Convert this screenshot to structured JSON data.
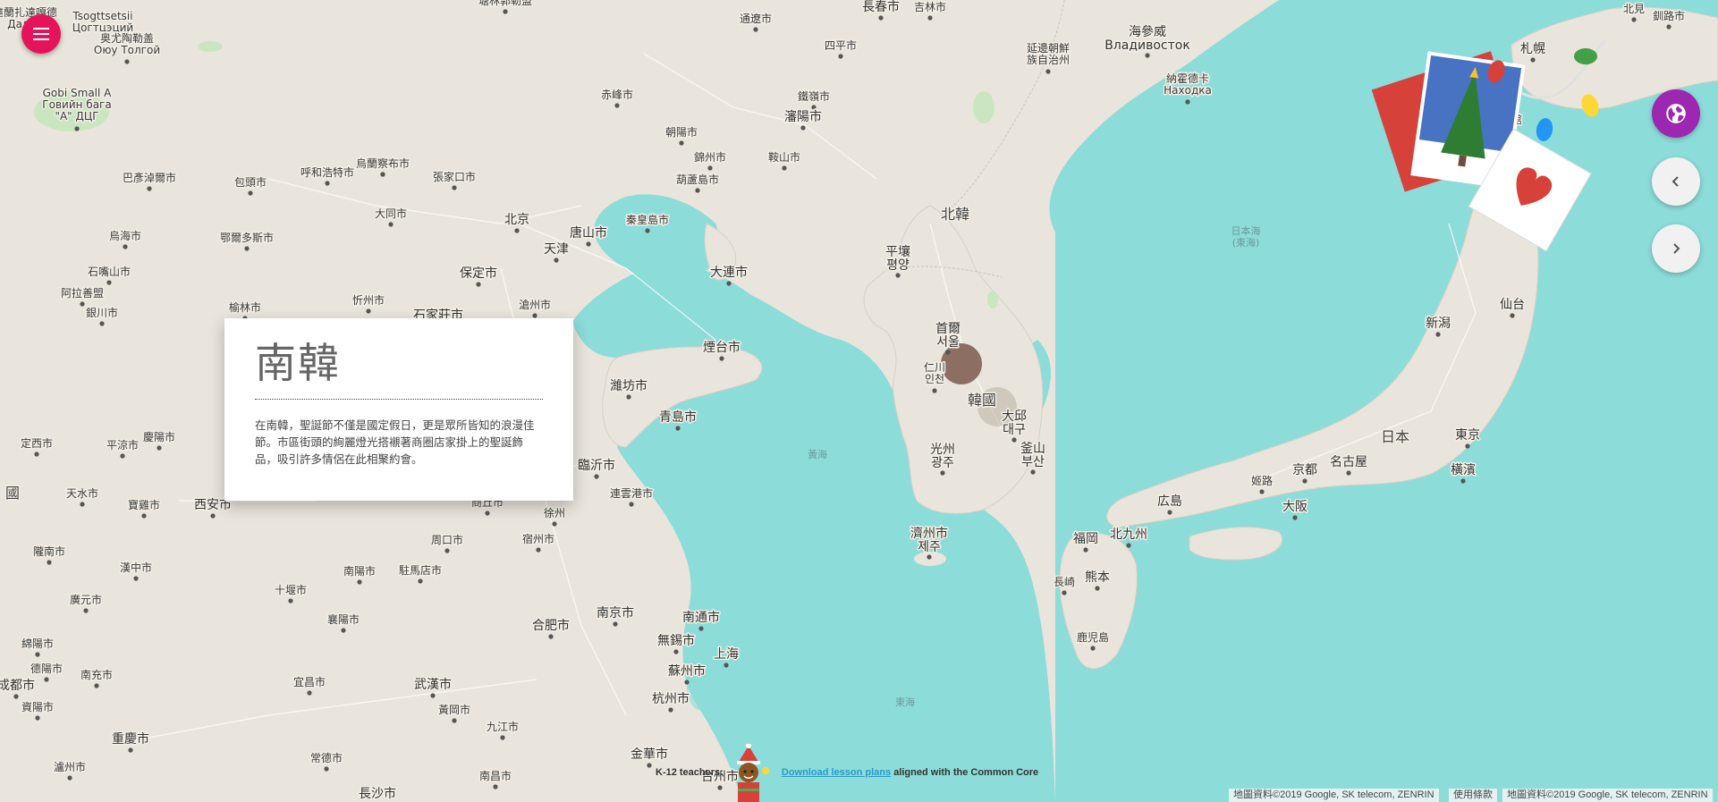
{
  "map": {
    "countries": [
      {
        "name": "北韓"
      },
      {
        "name": "韓國"
      },
      {
        "name": "日本"
      },
      {
        "name": "國"
      }
    ],
    "seas": [
      {
        "name": "黃海"
      },
      {
        "name": "東海"
      },
      {
        "name": "日本海\n(東海)"
      }
    ],
    "cities": [
      {
        "name": "長春市"
      },
      {
        "name": "吉林市"
      },
      {
        "name": "通遼市"
      },
      {
        "name": "四平市"
      },
      {
        "name": "海參威\nВладивосток"
      },
      {
        "name": "延邊朝鮮\n族自治州"
      },
      {
        "name": "納霍德卡\nНаходка"
      },
      {
        "name": "赤峰市"
      },
      {
        "name": "鐵嶺市"
      },
      {
        "name": "瀋陽市"
      },
      {
        "name": "朝陽市"
      },
      {
        "name": "錦州市"
      },
      {
        "name": "鞍山市"
      },
      {
        "name": "葫蘆島市"
      },
      {
        "name": "烏蘭察布市"
      },
      {
        "name": "呼和浩特市"
      },
      {
        "name": "張家口市"
      },
      {
        "name": "包頭市"
      },
      {
        "name": "巴彥淖爾市"
      },
      {
        "name": "大同市"
      },
      {
        "name": "北京"
      },
      {
        "name": "唐山市"
      },
      {
        "name": "秦皇島市"
      },
      {
        "name": "天津"
      },
      {
        "name": "鄂爾多斯市"
      },
      {
        "name": "烏海市"
      },
      {
        "name": "石嘴山市"
      },
      {
        "name": "保定市"
      },
      {
        "name": "大連市"
      },
      {
        "name": "阿拉善盟"
      },
      {
        "name": "銀川市"
      },
      {
        "name": "榆林市"
      },
      {
        "name": "忻州市"
      },
      {
        "name": "滄州市"
      },
      {
        "name": "煙台市"
      },
      {
        "name": "濰坊市"
      },
      {
        "name": "青島市"
      },
      {
        "name": "臨沂市"
      },
      {
        "name": "連雲港市"
      },
      {
        "name": "徐州"
      },
      {
        "name": "商丘市"
      },
      {
        "name": "宿州市"
      },
      {
        "name": "周口市"
      },
      {
        "name": "西安市"
      },
      {
        "name": "寶雞市"
      },
      {
        "name": "天水市"
      },
      {
        "name": "平涼市"
      },
      {
        "name": "定西市"
      },
      {
        "name": "慶陽市"
      },
      {
        "name": "隴南市"
      },
      {
        "name": "漢中市"
      },
      {
        "name": "廣元市"
      },
      {
        "name": "十堰市"
      },
      {
        "name": "南陽市"
      },
      {
        "name": "駐馬店市"
      },
      {
        "name": "襄陽市"
      },
      {
        "name": "合肥市"
      },
      {
        "name": "南京市"
      },
      {
        "name": "南通市"
      },
      {
        "name": "無錫市"
      },
      {
        "name": "蘇州市"
      },
      {
        "name": "上海"
      },
      {
        "name": "杭州市"
      },
      {
        "name": "武漢市"
      },
      {
        "name": "黃岡市"
      },
      {
        "name": "宜昌市"
      },
      {
        "name": "綿陽市"
      },
      {
        "name": "德陽市"
      },
      {
        "name": "成都市"
      },
      {
        "name": "南充市"
      },
      {
        "name": "資陽市"
      },
      {
        "name": "重慶市"
      },
      {
        "name": "瀘州市"
      },
      {
        "name": "常德市"
      },
      {
        "name": "長沙市"
      },
      {
        "name": "九江市"
      },
      {
        "name": "南昌市"
      },
      {
        "name": "金華市"
      },
      {
        "name": "台州市"
      },
      {
        "name": "平壤\n평양"
      },
      {
        "name": "首爾\n서울"
      },
      {
        "name": "仁川\n인천"
      },
      {
        "name": "大邱\n대구"
      },
      {
        "name": "光州\n광주"
      },
      {
        "name": "釜山\n부산"
      },
      {
        "name": "濟州市\n제주"
      },
      {
        "name": "札幌"
      },
      {
        "name": "北見"
      },
      {
        "name": "釧路市"
      },
      {
        "name": "函館"
      },
      {
        "name": "新潟"
      },
      {
        "name": "仙台"
      },
      {
        "name": "東京"
      },
      {
        "name": "橫濱"
      },
      {
        "name": "名古屋"
      },
      {
        "name": "京都"
      },
      {
        "name": "大阪"
      },
      {
        "name": "姬路"
      },
      {
        "name": "広島"
      },
      {
        "name": "福岡"
      },
      {
        "name": "北九州"
      },
      {
        "name": "熊本"
      },
      {
        "name": "長崎"
      },
      {
        "name": "鹿児島"
      },
      {
        "name": "Gobi Small A\nГовийн бага\n\"А\" ДЦГ"
      },
      {
        "name": "Tsogttsetsii\nЦогтцэций"
      },
      {
        "name": "奥尤陶勒盖\nОюу Толгой"
      },
      {
        "name": "石家莊市"
      },
      {
        "name": "塘林郭勒盟"
      },
      {
        "name": "烏蘭察布市"
      },
      {
        "name": "達蘭扎達嘎德\nДалан"
      }
    ],
    "highlight": {
      "location": "首爾"
    }
  },
  "menu": {
    "icon": "menu-icon"
  },
  "info_card": {
    "title": "南韓",
    "body": "在南韓，聖誕節不僅是國定假日，更是眾所皆知的浪漫佳節。市區街頭的絢麗燈光搭襯著商圈店家掛上的聖誕飾品，吸引許多情侶在此相聚約會。"
  },
  "controls": {
    "globe_icon": "globe-icon",
    "prev_icon": "chevron-left-icon",
    "next_icon": "chevron-right-icon"
  },
  "teacher_bar": {
    "prefix": "K-12 teachers:",
    "link": "Download lesson plans",
    "suffix": "aligned with the Common Core"
  },
  "attribution": {
    "left": "地圖資料©2019 Google, SK telecom, ZENRIN",
    "terms": "使用條款",
    "right": "地圖資料©2019 Google, SK telecom, ZENRIN"
  },
  "colors": {
    "water": "#8cdcda",
    "land": "#e9e5dc",
    "menu_button": "#e5145a",
    "globe_button": "#9c27b0",
    "marker": "#8d6e63"
  }
}
